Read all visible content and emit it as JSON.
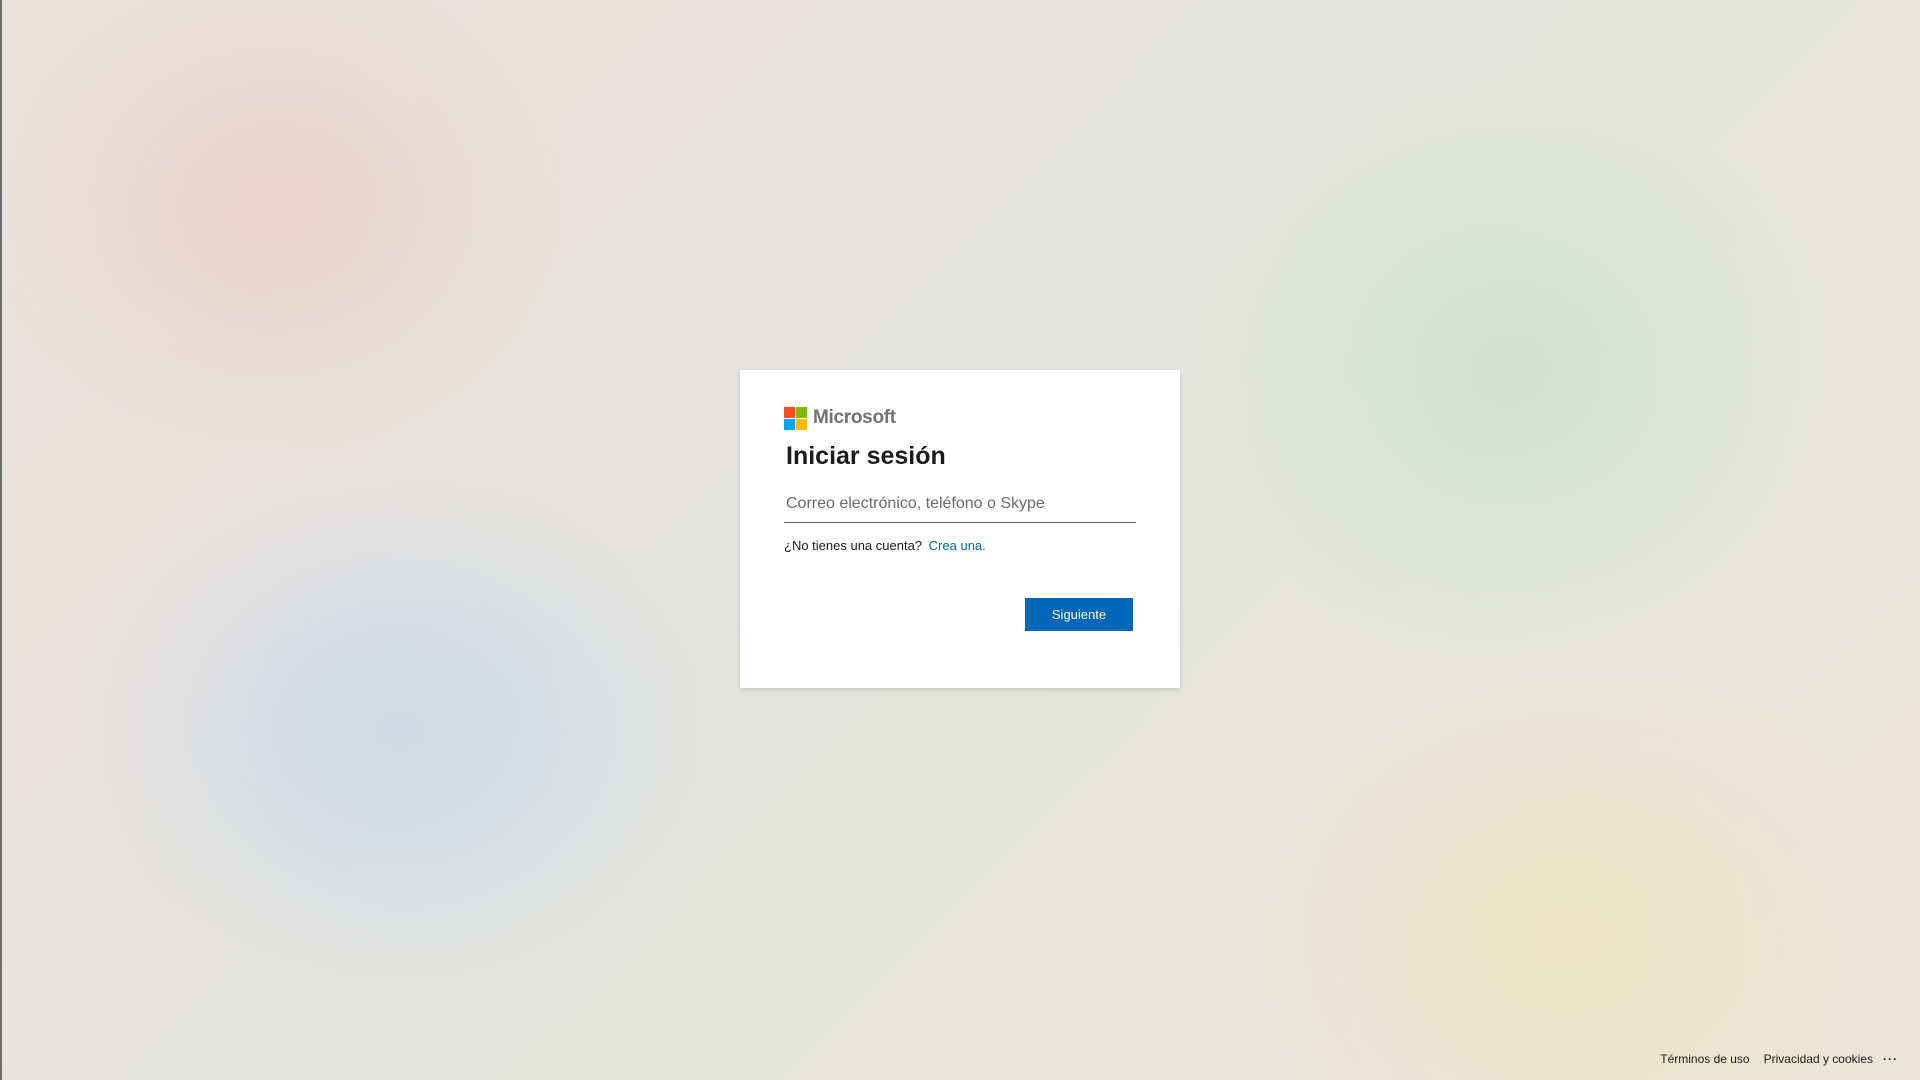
{
  "brand": {
    "name": "Microsoft",
    "logo_colors": [
      "#f25022",
      "#7fba00",
      "#00a4ef",
      "#ffb900"
    ]
  },
  "signin": {
    "title": "Iniciar sesión",
    "input_placeholder": "Correo electrónico, teléfono o Skype",
    "input_value": "",
    "no_account_text": "¿No tienes una cuenta?",
    "create_link": "Crea una",
    "create_link_suffix": ".",
    "next_button": "Siguiente"
  },
  "footer": {
    "terms": "Términos de uso",
    "privacy": "Privacidad y cookies",
    "more": "···"
  },
  "colors": {
    "accent": "#0067b8"
  }
}
